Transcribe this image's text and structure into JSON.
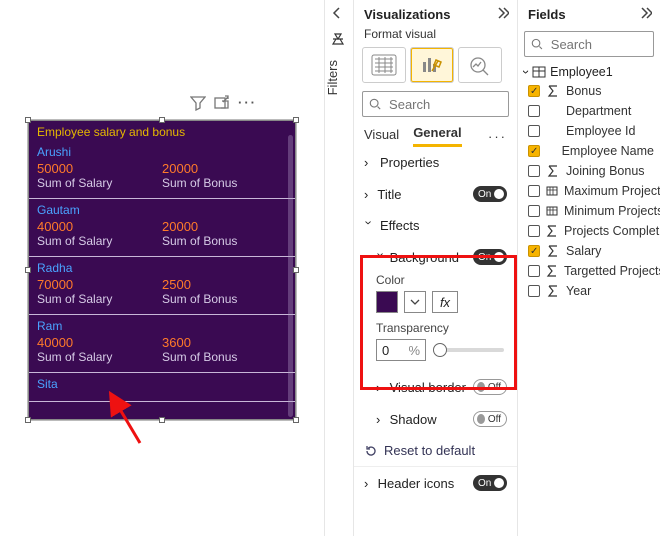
{
  "visual_header_icons": {
    "filter": "filter-icon",
    "popout": "focus-icon",
    "more": "more-icon"
  },
  "card": {
    "title": "Employee salary and bonus",
    "salary_label": "Sum of Salary",
    "bonus_label": "Sum of Bonus",
    "rows": [
      {
        "name": "Arushi",
        "salary": "50000",
        "bonus": "20000"
      },
      {
        "name": "Gautam",
        "salary": "40000",
        "bonus": "20000"
      },
      {
        "name": "Radha",
        "salary": "70000",
        "bonus": "2500"
      },
      {
        "name": "Ram",
        "salary": "40000",
        "bonus": "3600"
      },
      {
        "name": "Sita"
      }
    ]
  },
  "filters_label": "Filters",
  "vis_pane": {
    "title": "Visualizations",
    "subtitle": "Format visual",
    "search_placeholder": "Search",
    "tabs": {
      "visual": "Visual",
      "general": "General"
    },
    "sections": {
      "properties": "Properties",
      "title": "Title",
      "effects": "Effects",
      "background": "Background",
      "color": "Color",
      "transparency": "Transparency",
      "transparency_value": "0",
      "transparency_unit": "%",
      "visual_border": "Visual border",
      "shadow": "Shadow",
      "reset": "Reset to default",
      "header_icons": "Header icons"
    },
    "fx": "fx",
    "pill_on": "On",
    "pill_off": "Off",
    "background_color": "#3a0a52"
  },
  "fields_pane": {
    "title": "Fields",
    "search_placeholder": "Search",
    "table": "Employee1",
    "items": [
      {
        "label": "Bonus",
        "checked": true,
        "icon": "sigma"
      },
      {
        "label": "Department",
        "checked": false,
        "icon": "none"
      },
      {
        "label": "Employee Id",
        "checked": false,
        "icon": "none"
      },
      {
        "label": "Employee Name",
        "checked": true,
        "icon": "none"
      },
      {
        "label": "Joining Bonus",
        "checked": false,
        "icon": "sigma"
      },
      {
        "label": "Maximum Projects",
        "checked": false,
        "icon": "box"
      },
      {
        "label": "Minimum Projects",
        "checked": false,
        "icon": "box"
      },
      {
        "label": "Projects Complet...",
        "checked": false,
        "icon": "sigma"
      },
      {
        "label": "Salary",
        "checked": true,
        "icon": "sigma"
      },
      {
        "label": "Targetted Projects",
        "checked": false,
        "icon": "sigma"
      },
      {
        "label": "Year",
        "checked": false,
        "icon": "sigma"
      }
    ]
  }
}
